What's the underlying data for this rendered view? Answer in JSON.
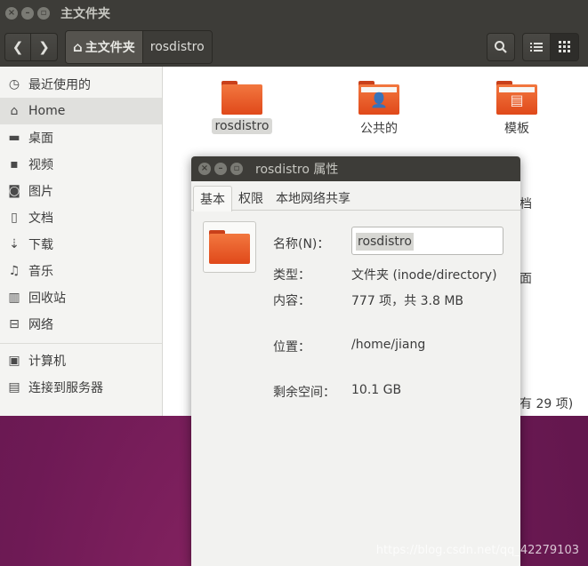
{
  "window": {
    "title": "主文件夹"
  },
  "toolbar": {
    "path": [
      {
        "label": "主文件夹"
      },
      {
        "label": "rosdistro"
      }
    ]
  },
  "sidebar": {
    "items": [
      {
        "label": "最近使用的",
        "icon": "clock-icon"
      },
      {
        "label": "Home",
        "icon": "home-icon",
        "active": true
      },
      {
        "label": "桌面",
        "icon": "desktop-folder-icon"
      },
      {
        "label": "视频",
        "icon": "video-icon"
      },
      {
        "label": "图片",
        "icon": "camera-icon"
      },
      {
        "label": "文档",
        "icon": "document-icon"
      },
      {
        "label": "下载",
        "icon": "download-icon"
      },
      {
        "label": "音乐",
        "icon": "music-icon"
      },
      {
        "label": "回收站",
        "icon": "trash-icon"
      },
      {
        "label": "网络",
        "icon": "network-icon"
      }
    ],
    "devices": [
      {
        "label": "计算机",
        "icon": "computer-icon"
      },
      {
        "label": "连接到服务器",
        "icon": "server-icon"
      }
    ]
  },
  "files": [
    {
      "name": "rosdistro",
      "selected": true
    },
    {
      "name": "公共的"
    },
    {
      "name": "模板"
    }
  ],
  "partial_labels": {
    "docs_tail": "档",
    "desktop_tail": "面",
    "status_tail": "有 29 项)"
  },
  "dialog": {
    "title": "rosdistro 属性",
    "tabs": [
      "基本",
      "权限",
      "本地网络共享"
    ],
    "name_label": "名称(N)：",
    "name_value": "rosdistro",
    "type_label": "类型：",
    "type_value": "文件夹 (inode/directory)",
    "contents_label": "内容：",
    "contents_value": "777 项，共 3.8 MB",
    "location_label": "位置：",
    "location_value": "/home/jiang",
    "free_label": "剩余空间：",
    "free_value": "10.1 GB"
  },
  "watermark": "https://blog.csdn.net/qq_42279103",
  "colors": {
    "folder": "#e8541f",
    "titlebar": "#3d3c38",
    "desktop": "#6e1a55"
  }
}
